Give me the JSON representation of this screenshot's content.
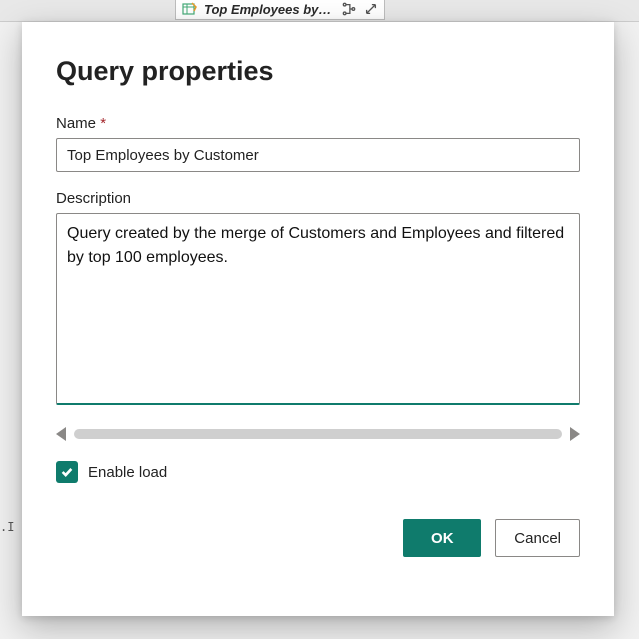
{
  "background": {
    "tab_title": "Top Employees by…",
    "side_snippet": ".I"
  },
  "dialog": {
    "title": "Query properties",
    "name_label": "Name",
    "required_mark": "*",
    "name_value": "Top Employees by Customer",
    "description_label": "Description",
    "description_value": "Query created by the merge of Customers and Employees and filtered by top 100 employees.",
    "enable_load_label": "Enable load",
    "enable_load_checked": true,
    "ok_label": "OK",
    "cancel_label": "Cancel"
  }
}
